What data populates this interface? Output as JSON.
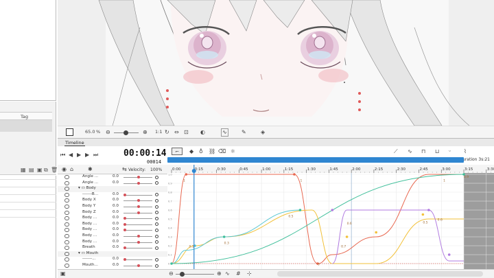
{
  "left_panel": {
    "tag_header": "Tag"
  },
  "canvas_toolbar": {
    "zoom_value": "65.0",
    "zoom_unit": "%",
    "ratio_label": "1:1"
  },
  "timeline": {
    "tab_label": "Timeline",
    "current_time": "00:00:14",
    "current_frame": "00014",
    "duration_label": "Duration 3s:21",
    "velocity_label": "Velocity:",
    "velocity_value": "100%",
    "ruler_ticks": [
      "0:00",
      "0:15",
      "0:30",
      "0:45",
      "1:00",
      "1:15",
      "1:30",
      "1:45",
      "2:00",
      "2:15",
      "2:30",
      "2:45",
      "3:00",
      "3:15",
      "3:30"
    ],
    "y_ticks": [
      "1.0",
      "0.9",
      "0.8",
      "0.7",
      "0.6",
      "0.5",
      "0.4",
      "0.3",
      "0.2",
      "0.1",
      "0"
    ],
    "tracks": [
      {
        "label": "Angle ...",
        "value": "0.0",
        "type": "param",
        "knob": 0.5
      },
      {
        "label": "Angle ...",
        "value": "0.0",
        "type": "param",
        "knob": 0.5
      },
      {
        "label": "Body",
        "value": "",
        "type": "group",
        "knob": null
      },
      {
        "label": "-------B...",
        "value": "0.0",
        "type": "param",
        "knob": 0.0
      },
      {
        "label": "Body X",
        "value": "0.0",
        "type": "param",
        "knob": 0.5
      },
      {
        "label": "Body Y",
        "value": "0.0",
        "type": "param",
        "knob": 0.5
      },
      {
        "label": "Body Z",
        "value": "0.0",
        "type": "param",
        "knob": 0.5
      },
      {
        "label": "Body ...",
        "value": "0.0",
        "type": "param",
        "knob": 0.0
      },
      {
        "label": "Body ...",
        "value": "0.0",
        "type": "param",
        "knob": 0.0
      },
      {
        "label": "Body ...",
        "value": "0.0",
        "type": "param",
        "knob": 0.0
      },
      {
        "label": "Body ...",
        "value": "0.0",
        "type": "param",
        "knob": 0.5
      },
      {
        "label": "Body ...",
        "value": "0.0",
        "type": "param",
        "knob": 0.5
      },
      {
        "label": "Breath",
        "value": "0.0",
        "type": "param",
        "knob": 0.0
      },
      {
        "label": "Mouth",
        "value": "",
        "type": "group",
        "knob": null
      },
      {
        "label": "-------...",
        "value": "0.0",
        "type": "param",
        "knob": 0.0
      },
      {
        "label": "Mouth...",
        "value": "0.0",
        "type": "param",
        "knob": 0.5
      }
    ],
    "curve_labels": [
      "0.1",
      "0.3",
      "0.5",
      "1",
      "1",
      "0.7",
      "0.6",
      "0.5",
      "0.6",
      "1",
      "0.9",
      "0"
    ],
    "colors": {
      "red": "#e8674f",
      "teal": "#3fbf9a",
      "purple": "#b07ae0",
      "yellow": "#f2c13a",
      "cyan": "#56c6d3",
      "scrub_bar": "#2f86d1",
      "playhead": "#2f86d1"
    }
  }
}
